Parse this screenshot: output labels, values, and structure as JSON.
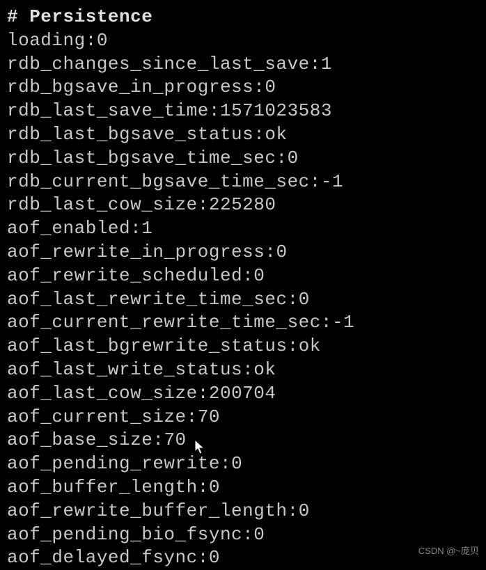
{
  "terminal": {
    "header": "# Persistence",
    "lines": [
      {
        "key": "loading",
        "value": "0"
      },
      {
        "key": "rdb_changes_since_last_save",
        "value": "1"
      },
      {
        "key": "rdb_bgsave_in_progress",
        "value": "0"
      },
      {
        "key": "rdb_last_save_time",
        "value": "1571023583"
      },
      {
        "key": "rdb_last_bgsave_status",
        "value": "ok"
      },
      {
        "key": "rdb_last_bgsave_time_sec",
        "value": "0"
      },
      {
        "key": "rdb_current_bgsave_time_sec",
        "value": "-1"
      },
      {
        "key": "rdb_last_cow_size",
        "value": "225280"
      },
      {
        "key": "aof_enabled",
        "value": "1"
      },
      {
        "key": "aof_rewrite_in_progress",
        "value": "0"
      },
      {
        "key": "aof_rewrite_scheduled",
        "value": "0"
      },
      {
        "key": "aof_last_rewrite_time_sec",
        "value": "0"
      },
      {
        "key": "aof_current_rewrite_time_sec",
        "value": "-1"
      },
      {
        "key": "aof_last_bgrewrite_status",
        "value": "ok"
      },
      {
        "key": "aof_last_write_status",
        "value": "ok"
      },
      {
        "key": "aof_last_cow_size",
        "value": "200704"
      },
      {
        "key": "aof_current_size",
        "value": "70"
      },
      {
        "key": "aof_base_size",
        "value": "70"
      },
      {
        "key": "aof_pending_rewrite",
        "value": "0"
      },
      {
        "key": "aof_buffer_length",
        "value": "0"
      },
      {
        "key": "aof_rewrite_buffer_length",
        "value": "0"
      },
      {
        "key": "aof_pending_bio_fsync",
        "value": "0"
      },
      {
        "key": "aof_delayed_fsync",
        "value": "0"
      }
    ]
  },
  "watermark": "CSDN @~庞贝"
}
